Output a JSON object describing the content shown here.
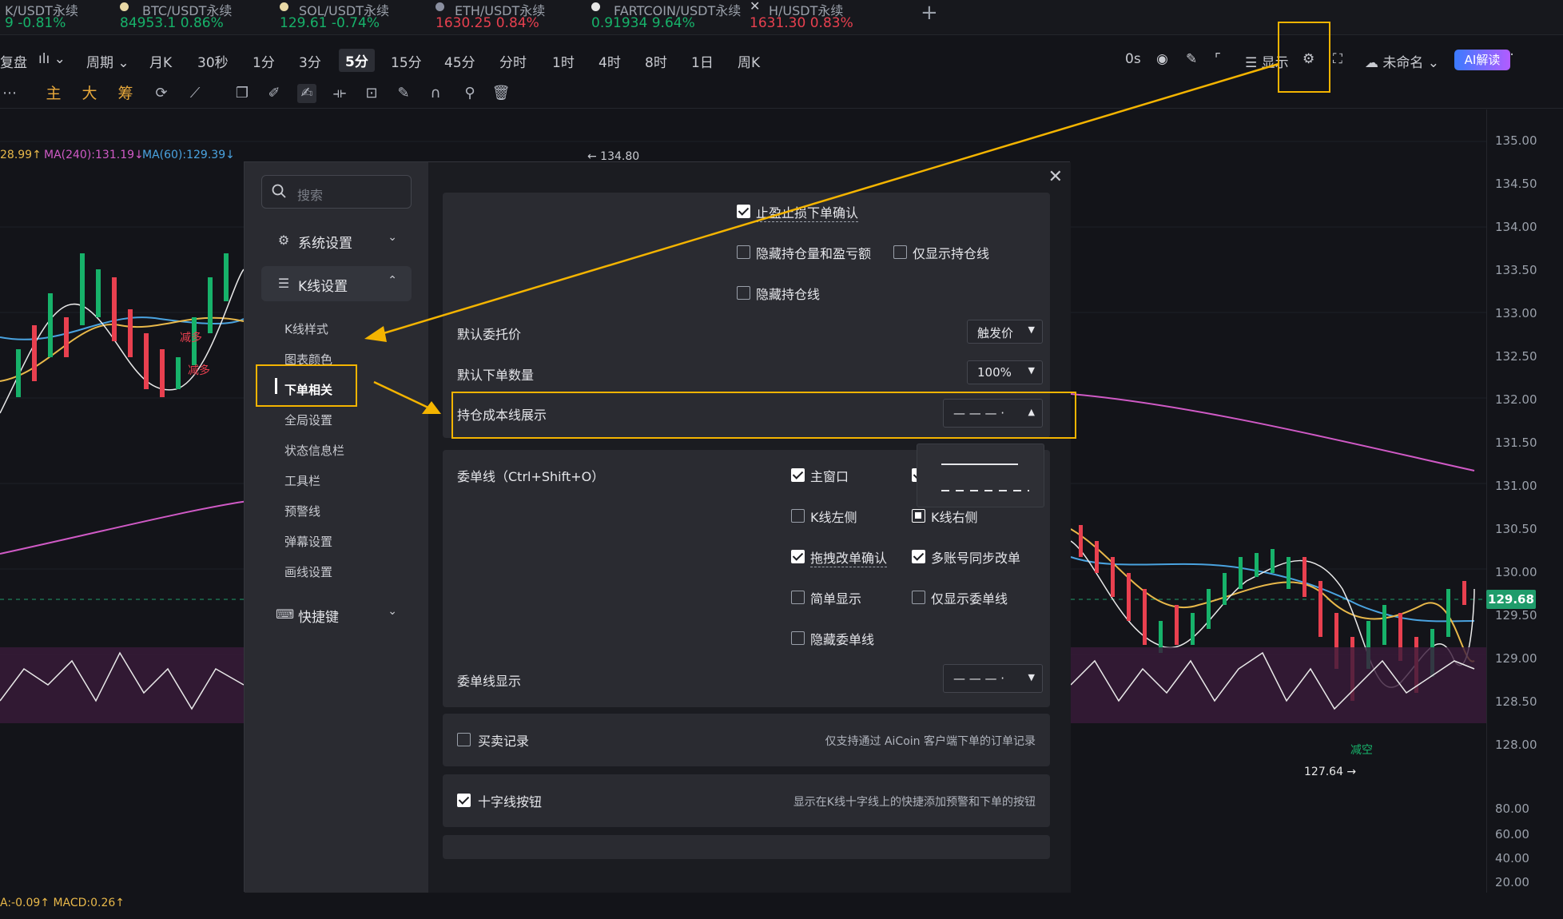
{
  "tickers": [
    {
      "name": "K/USDT永续",
      "price": "9",
      "change": "-0.81%",
      "dir": "down"
    },
    {
      "name": "BTC/USDT永续",
      "price": "84953.1",
      "change": "0.86%",
      "dir": "up"
    },
    {
      "name": "SOL/USDT永续",
      "price": "129.61",
      "change": "-0.74%",
      "dir": "down"
    },
    {
      "name": "ETH/USDT永续",
      "price": "1630.25",
      "change": "0.84%",
      "dir": "up"
    },
    {
      "name": "FARTCOIN/USDT永续",
      "price": "0.91934",
      "change": "9.64%",
      "dir": "up"
    },
    {
      "name": "H/USDT永续",
      "price": "1631.30",
      "change": "0.83%",
      "dir": "up"
    }
  ],
  "toolbar": {
    "replay": "复盘",
    "chart_type_icon": "candle-type-icon",
    "period": "周期",
    "intervals": [
      "月K",
      "30秒",
      "1分",
      "3分",
      "5分",
      "15分",
      "45分",
      "分时",
      "1时",
      "4时",
      "8时",
      "1日",
      "周K"
    ],
    "selected_interval": "5分",
    "countdown": "0s",
    "display": "显示",
    "layout_name": "未命名",
    "ai_button": "AI解读"
  },
  "drawing_tools": {
    "main": "主",
    "big": "大",
    "chips": "筹"
  },
  "ma_legend": [
    {
      "text": "28.99↑",
      "color": "#e8b84a"
    },
    {
      "text": "MA(240):131.19↓",
      "color": "#d05ac6"
    },
    {
      "text": "MA(60):129.39↓",
      "color": "#4aa3e0"
    }
  ],
  "chart_labels": {
    "high_mark": "← 134.80",
    "low_mark": "127.64 →",
    "reduce_long": "减多",
    "reduce_long_2": "减多",
    "short": "减空",
    "macd": "A:-0.09↑ MACD:0.26↑"
  },
  "y_axis": [
    "135.00",
    "134.50",
    "134.00",
    "133.50",
    "133.00",
    "132.50",
    "132.00",
    "131.50",
    "131.00",
    "130.50",
    "130.00",
    "129.50",
    "129.00",
    "128.50",
    "128.00"
  ],
  "last_price": "129.68",
  "rsi_axis": [
    "80.00",
    "60.00",
    "40.00",
    "20.00"
  ],
  "dialog": {
    "search_placeholder": "搜索",
    "groups": {
      "system": "系统设置",
      "kline": "K线设置",
      "hotkeys": "快捷键"
    },
    "kline_items": [
      "K线样式",
      "图表颜色",
      "下单相关",
      "全局设置",
      "状态信息栏",
      "工具栏",
      "预警线",
      "弹幕设置",
      "画线设置"
    ],
    "current_item": "下单相关",
    "order_panel": {
      "tp_sl_confirm": "止盈止损下单确认",
      "hide_pos_pnl": "隐藏持仓量和盈亏额",
      "only_pos_line": "仅显示持仓线",
      "hide_pos_line": "隐藏持仓线",
      "default_price_label": "默认委托价",
      "default_price_value": "触发价",
      "default_qty_label": "默认下单数量",
      "default_qty_value": "100%",
      "cost_line_label": "持仓成本线展示",
      "cost_line_value": "— — — ·"
    },
    "order_line_panel": {
      "title": "委单线（Ctrl+Shift+O）",
      "main_window": "主窗口",
      "kline_left": "K线左侧",
      "kline_right": "K线右侧",
      "drag_confirm": "拖拽改单确认",
      "multi_sync": "多账号同步改单",
      "simple_display": "简单显示",
      "only_order_line": "仅显示委单线",
      "hide_order_line": "隐藏委单线",
      "display_label": "委单线显示",
      "display_value": "— — — ·"
    },
    "trade_record": {
      "label": "买卖记录",
      "hint": "仅支持通过 AiCoin 客户端下单的订单记录"
    },
    "crosshair": {
      "label": "十字线按钮",
      "hint": "显示在K线十字线上的快捷添加预警和下单的按钮"
    }
  },
  "colors": {
    "highlight": "#f4b400",
    "up": "#17b26a",
    "down": "#e8404f",
    "price_tag": "#1f9c6b"
  }
}
